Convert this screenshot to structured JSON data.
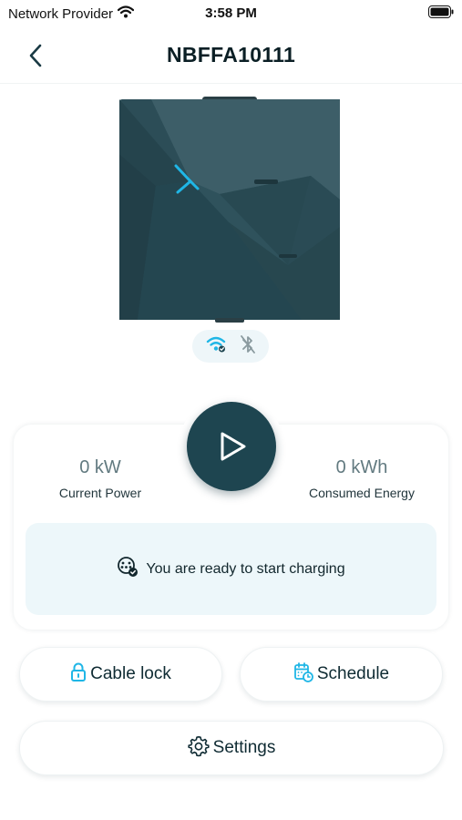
{
  "status_bar": {
    "carrier": "Network Provider",
    "time": "3:58 PM"
  },
  "header": {
    "title": "NBFFA10111"
  },
  "connectivity": {
    "wifi": "connected",
    "bluetooth": "disabled"
  },
  "stats": {
    "current_power": {
      "value": "0 kW",
      "label": "Current Power"
    },
    "consumed_energy": {
      "value": "0 kWh",
      "label": "Consumed Energy"
    }
  },
  "status_message": "You are ready to start charging",
  "buttons": {
    "cable_lock": "Cable lock",
    "schedule": "Schedule",
    "settings": "Settings"
  },
  "colors": {
    "accent": "#1fb6e6",
    "primary_dark": "#1e4550",
    "banner_bg": "#edf7fa"
  }
}
